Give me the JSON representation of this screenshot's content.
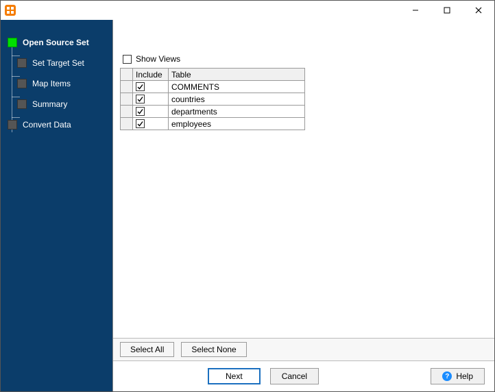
{
  "window": {
    "minimize": "—",
    "maximize": "▢",
    "close": "✕"
  },
  "sidebar": {
    "items": [
      {
        "label": "Open Source Set",
        "active": true,
        "indent": false
      },
      {
        "label": "Set Target Set",
        "active": false,
        "indent": true
      },
      {
        "label": "Map Items",
        "active": false,
        "indent": true
      },
      {
        "label": "Summary",
        "active": false,
        "indent": true
      },
      {
        "label": "Convert Data",
        "active": false,
        "indent": false
      }
    ]
  },
  "main": {
    "show_views_label": "Show Views",
    "show_views_checked": false,
    "columns": {
      "include": "Include",
      "table": "Table"
    },
    "rows": [
      {
        "include": true,
        "table": "COMMENTS"
      },
      {
        "include": true,
        "table": "countries"
      },
      {
        "include": true,
        "table": "departments"
      },
      {
        "include": true,
        "table": "employees"
      }
    ],
    "select_all": "Select All",
    "select_none": "Select None"
  },
  "footer": {
    "next": "Next",
    "cancel": "Cancel",
    "help": "Help"
  }
}
